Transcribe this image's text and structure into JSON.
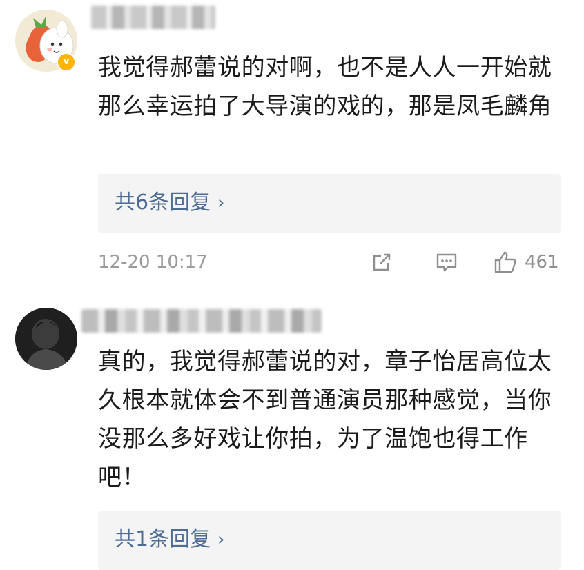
{
  "comments": [
    {
      "text": "我觉得郝蕾说的对啊，也不是人人一开始就那么幸运拍了大导演的戏的，那是凤毛麟角",
      "verified_badge": "v",
      "replies_label": "共6条回复",
      "timestamp": "12-20 10:17",
      "likes": "461"
    },
    {
      "text": "真的，我觉得郝蕾说的对，章子怡居高位太久根本就体会不到普通演员那种感觉，当你没那么多好戏让你拍，为了温饱也得工作吧！",
      "replies_label": "共1条回复"
    }
  ],
  "icons": {
    "share": "share-icon",
    "comment": "comment-icon",
    "like": "thumbs-up-icon",
    "chevron": "chevron-right-icon"
  },
  "colors": {
    "link": "#4c6c93",
    "meta": "#9a9a9a",
    "reply_bg": "#f4f4f4",
    "badge": "#ffb400"
  }
}
